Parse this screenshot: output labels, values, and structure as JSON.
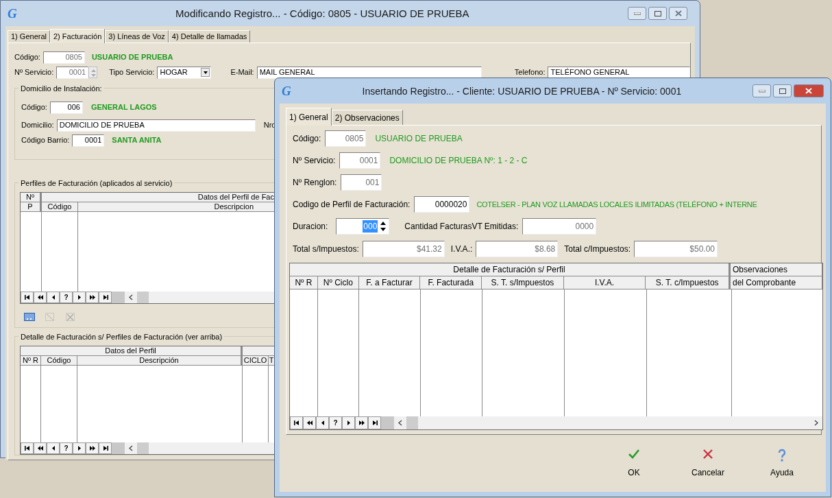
{
  "main_window": {
    "logo": "G",
    "title": "Modificando Registro... - Código: 0805 - USUARIO DE PRUEBA",
    "tabs": [
      {
        "label": "1) General",
        "selected": false
      },
      {
        "label": "2) Facturación",
        "selected": true
      },
      {
        "label": "3) Líneas de Voz",
        "selected": false
      },
      {
        "label": "4) Detalle de llamadas",
        "selected": false
      }
    ],
    "codigo": {
      "label": "Código:",
      "value": "0805",
      "disabled": true,
      "name": "USUARIO DE PRUEBA"
    },
    "servicio": {
      "label": "Nº Servicio:",
      "value": "0001",
      "disabled": true
    },
    "tipo_servicio": {
      "label": "Tipo Servicio:",
      "value": "HOGAR"
    },
    "email": {
      "label": "E-Mail:",
      "value": "MAIL GENERAL"
    },
    "telefono": {
      "label": "Telefono:",
      "value": "TELÉFONO GENERAL"
    },
    "domicilio_instalacion": {
      "title": "Domicilio de Instalación:",
      "codigo": {
        "label": "Código:",
        "value": "006",
        "disabled": false,
        "name": "GENERAL LAGOS"
      },
      "domicilio": {
        "label": "Domicilio:",
        "value": "DOMICILIO DE PRUEBA"
      },
      "nro_label": "Nro",
      "barrio": {
        "label": "Código Barrio:",
        "value": "0001",
        "disabled": false,
        "name": "SANTA ANITA"
      }
    },
    "perfiles": {
      "title": "Perfiles de Facturación (aplicados al servicio)",
      "group_header": "Datos del Perfil de Fac",
      "first_column": {
        "top": "Nº",
        "label": "P"
      },
      "columns": [
        "Código",
        "Descripcion"
      ],
      "navigator": [
        {
          "kind": "first"
        },
        {
          "kind": "prev_page"
        },
        {
          "kind": "prev"
        },
        {
          "kind": "refresh",
          "label": "?"
        },
        {
          "kind": "next"
        },
        {
          "kind": "next_page"
        },
        {
          "kind": "last"
        }
      ],
      "toolbar": [
        {
          "kind": "form",
          "disabled": false
        },
        {
          "kind": "edit",
          "disabled": true
        },
        {
          "kind": "delete",
          "disabled": true
        }
      ]
    },
    "detalle": {
      "title": "Detalle de Facturación s/ Perfiles de Facturación (ver arriba)",
      "group_header": "Datos del Perfil",
      "columns": [
        "Nº R",
        "Código",
        "Descripción"
      ],
      "extra_columns": [
        "CICLO",
        "T"
      ],
      "navigator": [
        {
          "kind": "first"
        },
        {
          "kind": "prev_page"
        },
        {
          "kind": "prev"
        },
        {
          "kind": "refresh",
          "label": "?"
        },
        {
          "kind": "next"
        },
        {
          "kind": "next_page"
        },
        {
          "kind": "last"
        }
      ]
    }
  },
  "dialog": {
    "logo": "G",
    "title": "Insertando Registro... - Cliente: USUARIO DE PRUEBA - Nº Servicio: 0001",
    "tabs": [
      {
        "label": "1) General",
        "selected": true
      },
      {
        "label": "2) Observaciones",
        "selected": false
      }
    ],
    "codigo": {
      "label": "Código:",
      "value": "0805",
      "disabled": true,
      "name": "USUARIO DE PRUEBA"
    },
    "servicio": {
      "label": "Nº Servicio:",
      "value": "0001",
      "disabled": true,
      "name": "DOMICILIO DE PRUEBA Nº: 1 - 2 - C"
    },
    "renglon": {
      "label": "Nº Renglon:",
      "value": "001",
      "disabled": true
    },
    "perfil": {
      "label": "Codigo de Perfil de Facturación:",
      "value": "0000020",
      "disabled": false,
      "name": "COTELSER - PLAN VOZ LLAMADAS LOCALES ILIMITADAS (TELÉFONO + INTERNE"
    },
    "duracion": {
      "label": "Duracion:",
      "value": "000",
      "selected": true
    },
    "cantidad": {
      "label": "Cantidad FacturasVT Emitidas:",
      "value": "0000",
      "disabled": true
    },
    "totals": [
      {
        "label": "Total s/Impuestos:",
        "value": "$41.32",
        "disabled": true
      },
      {
        "label": "I.V.A.:",
        "value": "$8.68",
        "disabled": true
      },
      {
        "label": "Total c/Impuestos:",
        "value": "$50.00",
        "disabled": true
      }
    ],
    "grid": {
      "group_header": "Detalle de Facturación s/ Perfil",
      "columns": [
        "Nº R",
        "Nº Ciclo",
        "F. a Facturar",
        "F. Facturada",
        "S. T. s/Impuestos",
        "I.V.A.",
        "S. T. c/Impuestos"
      ],
      "extra_column": {
        "top": "Observaciones",
        "label": "del Comprobante"
      },
      "navigator": [
        {
          "kind": "first"
        },
        {
          "kind": "prev_page"
        },
        {
          "kind": "prev"
        },
        {
          "kind": "refresh",
          "label": "?"
        },
        {
          "kind": "next"
        },
        {
          "kind": "next_page"
        },
        {
          "kind": "last"
        }
      ]
    },
    "buttons": [
      {
        "kind": "ok",
        "label": "OK"
      },
      {
        "kind": "cancel",
        "label": "Cancelar"
      },
      {
        "kind": "help",
        "label": "Ayuda"
      }
    ]
  }
}
